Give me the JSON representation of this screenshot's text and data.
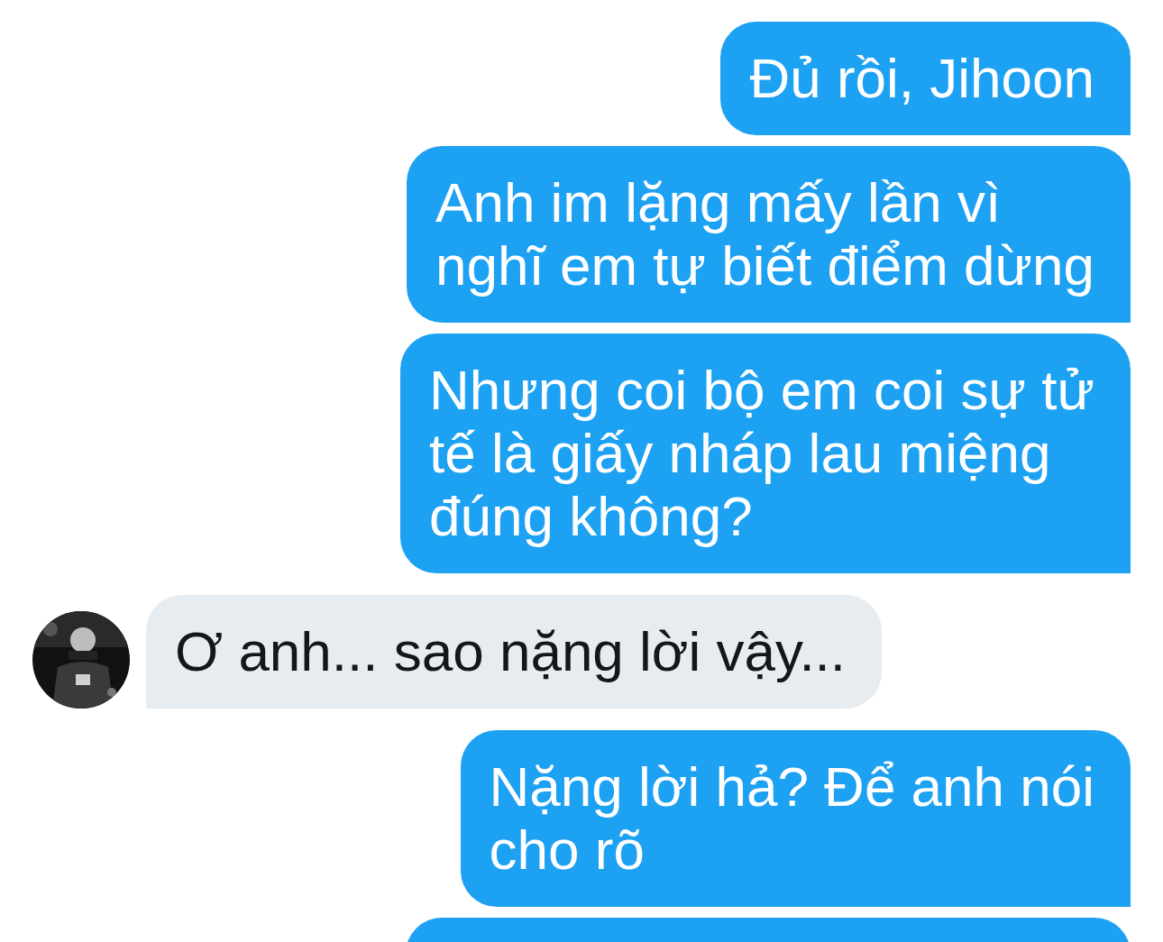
{
  "messages": [
    {
      "kind": "outgoing",
      "text": "Đủ rồi, Jihoon"
    },
    {
      "kind": "outgoing",
      "text": "Anh im lặng mấy lần vì\nnghĩ em tự biết điểm dừng"
    },
    {
      "kind": "outgoing",
      "text": "Nhưng coi bộ em coi sự tử\ntế là giấy nháp lau miệng\nđúng không?"
    },
    {
      "kind": "incoming",
      "text": "Ơ anh... sao nặng lời vậy..."
    },
    {
      "kind": "outgoing",
      "text": "Nặng lời hả? Để anh nói\ncho rõ"
    },
    {
      "kind": "cut_off"
    }
  ]
}
